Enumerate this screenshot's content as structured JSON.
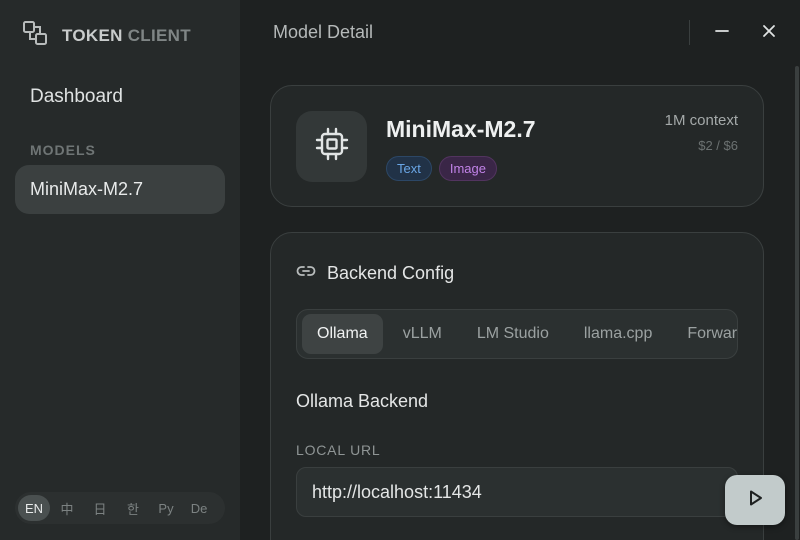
{
  "brand": {
    "name_a": "TOKEN",
    "name_b": "CLIENT",
    "icon": "logo-icon"
  },
  "sidebar": {
    "dashboard_label": "Dashboard",
    "models_section_label": "MODELS",
    "models": [
      {
        "label": "MiniMax-M2.7",
        "selected": true
      }
    ],
    "languages": [
      {
        "label": "EN",
        "active": true
      },
      {
        "label": "中",
        "active": false
      },
      {
        "label": "日",
        "active": false
      },
      {
        "label": "한",
        "active": false
      },
      {
        "label": "Ру",
        "active": false
      },
      {
        "label": "De",
        "active": false
      }
    ]
  },
  "header": {
    "title": "Model Detail",
    "minimize_icon": "minus-icon",
    "close_icon": "close-icon"
  },
  "model": {
    "icon": "chip-icon",
    "name": "MiniMax-M2.7",
    "tags": [
      "Text",
      "Image"
    ],
    "context": "1M context",
    "price": "$2 / $6"
  },
  "backend": {
    "icon": "link-icon",
    "title": "Backend Config",
    "tabs": [
      {
        "label": "Ollama",
        "active": true
      },
      {
        "label": "vLLM",
        "active": false
      },
      {
        "label": "LM Studio",
        "active": false
      },
      {
        "label": "llama.cpp",
        "active": false
      },
      {
        "label": "Forwarding",
        "active": false
      }
    ],
    "subtitle": "Ollama Backend",
    "url_label": "LOCAL URL",
    "url_value": "http://localhost:11434",
    "run_icon": "play-icon"
  },
  "colors": {
    "background": "#1e2121",
    "sidebar": "#262a2a",
    "text_tag": "#6aa6e6",
    "image_tag": "#c183e8",
    "run_button": "#c2cbcb"
  }
}
